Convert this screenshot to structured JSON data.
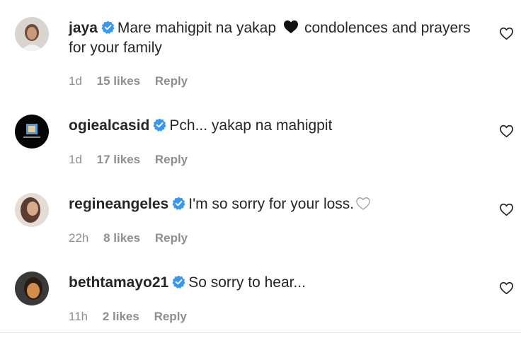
{
  "comments": [
    {
      "username": "jaya",
      "text_before_heart": "Mare mahigpit na yakap",
      "text_after_heart": "condolences and prayers for your family",
      "time": "1d",
      "likes": "15 likes",
      "reply": "Reply"
    },
    {
      "username": "ogiealcasid",
      "text": "Pch... yakap na mahigpit",
      "time": "1d",
      "likes": "17 likes",
      "reply": "Reply"
    },
    {
      "username": "regineangeles",
      "text": "I'm so sorry for your loss.",
      "time": "22h",
      "likes": "8 likes",
      "reply": "Reply"
    },
    {
      "username": "bethtamayo21",
      "text": "So sorry to hear...",
      "time": "11h",
      "likes": "2 likes",
      "reply": "Reply"
    }
  ],
  "colors": {
    "verified": "#3897f0",
    "muted_text": "#8e8e8e",
    "primary_text": "#262626"
  },
  "icons": {
    "verified": "verified-badge-icon",
    "like": "heart-outline-icon",
    "inline_heart": "black-heart-icon"
  }
}
